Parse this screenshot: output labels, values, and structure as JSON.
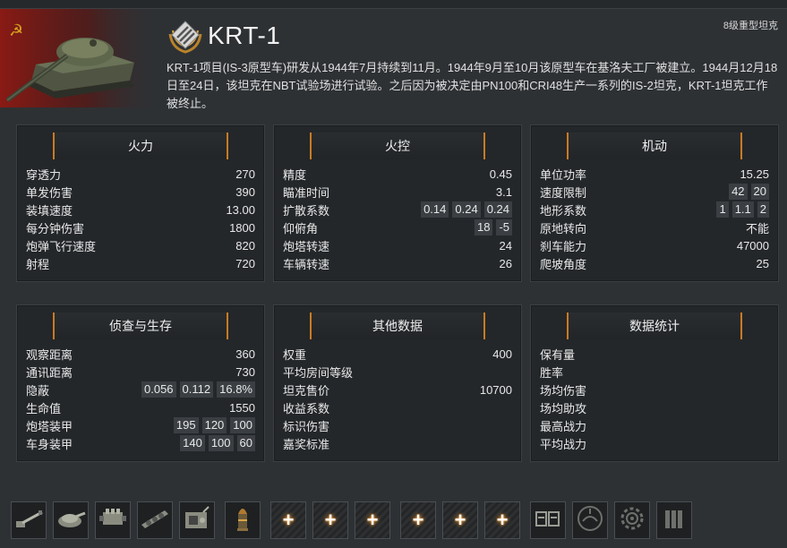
{
  "vehicle": {
    "name": "KRT-1",
    "class_label": "8级重型坦克",
    "description": "KRT-1项目(IS-3原型车)研发从1944年7月持续到11月。1944年9月至10月该原型车在基洛夫工厂被建立。1944月12月18日至24日，该坦克在NBT试验场进行试验。之后因为被决定由PN100和CRI48生产一系列的IS-2坦克，KRT-1坦克工作被终止。"
  },
  "panels": {
    "firepower": {
      "title": "火力",
      "rows": [
        {
          "label": "穿透力",
          "values": [
            "270"
          ]
        },
        {
          "label": "单发伤害",
          "values": [
            "390"
          ]
        },
        {
          "label": "装填速度",
          "values": [
            "13.00"
          ]
        },
        {
          "label": "每分钟伤害",
          "values": [
            "1800"
          ]
        },
        {
          "label": "炮弹飞行速度",
          "values": [
            "820"
          ]
        },
        {
          "label": "射程",
          "values": [
            "720"
          ]
        }
      ]
    },
    "fire_control": {
      "title": "火控",
      "rows": [
        {
          "label": "精度",
          "values": [
            "0.45"
          ]
        },
        {
          "label": "瞄准时间",
          "values": [
            "3.1"
          ]
        },
        {
          "label": "扩散系数",
          "values": [
            "0.14",
            "0.24",
            "0.24"
          ]
        },
        {
          "label": "仰俯角",
          "values": [
            "18",
            "-5"
          ]
        },
        {
          "label": "炮塔转速",
          "values": [
            "24"
          ]
        },
        {
          "label": "车辆转速",
          "values": [
            "26"
          ]
        }
      ]
    },
    "mobility": {
      "title": "机动",
      "rows": [
        {
          "label": "单位功率",
          "values": [
            "15.25"
          ]
        },
        {
          "label": "速度限制",
          "values": [
            "42",
            "20"
          ]
        },
        {
          "label": "地形系数",
          "values": [
            "1",
            "1.1",
            "2"
          ]
        },
        {
          "label": "原地转向",
          "values": [
            "不能"
          ]
        },
        {
          "label": "刹车能力",
          "values": [
            "47000"
          ]
        },
        {
          "label": "爬坡角度",
          "values": [
            "25"
          ]
        }
      ]
    },
    "recon": {
      "title": "侦查与生存",
      "rows": [
        {
          "label": "观察距离",
          "values": [
            "360"
          ]
        },
        {
          "label": "通讯距离",
          "values": [
            "730"
          ]
        },
        {
          "label": "隐蔽",
          "values": [
            "0.056",
            "0.112",
            "16.8%"
          ]
        },
        {
          "label": "生命值",
          "values": [
            "1550"
          ]
        },
        {
          "label": "炮塔装甲",
          "values": [
            "195",
            "120",
            "100"
          ]
        },
        {
          "label": "车身装甲",
          "values": [
            "140",
            "100",
            "60"
          ]
        }
      ]
    },
    "other": {
      "title": "其他数据",
      "rows": [
        {
          "label": "权重",
          "values": [
            "400"
          ]
        },
        {
          "label": "平均房间等级",
          "values": []
        },
        {
          "label": "坦克售价",
          "values": [
            "10700"
          ]
        },
        {
          "label": "收益系数",
          "values": []
        },
        {
          "label": "标识伤害",
          "values": []
        },
        {
          "label": "嘉奖标准",
          "values": []
        }
      ]
    },
    "stats": {
      "title": "数据统计",
      "rows": [
        {
          "label": "保有量",
          "values": []
        },
        {
          "label": "胜率",
          "values": []
        },
        {
          "label": "场均伤害",
          "values": []
        },
        {
          "label": "场均助攻",
          "values": []
        },
        {
          "label": "最高战力",
          "values": []
        },
        {
          "label": "平均战力",
          "values": []
        }
      ]
    }
  },
  "slots": [
    {
      "name": "gun-module-slot",
      "icon": "gun-icon",
      "empty": false
    },
    {
      "name": "turret-module-slot",
      "icon": "turret-icon",
      "empty": false
    },
    {
      "name": "engine-module-slot",
      "icon": "engine-icon",
      "empty": false
    },
    {
      "name": "suspension-module-slot",
      "icon": "suspension-icon",
      "empty": false
    },
    {
      "name": "radio-module-slot",
      "icon": "radio-icon",
      "empty": false
    },
    {
      "name": "ammo-slot",
      "icon": "shell-icon",
      "empty": false,
      "group_gap": true
    },
    {
      "name": "consumable-slot-1",
      "icon": "plus-icon",
      "empty": true,
      "group_gap": true
    },
    {
      "name": "consumable-slot-2",
      "icon": "plus-icon",
      "empty": true
    },
    {
      "name": "consumable-slot-3",
      "icon": "plus-icon",
      "empty": true
    },
    {
      "name": "equipment-slot-1",
      "icon": "plus-icon",
      "empty": true,
      "group_gap": true
    },
    {
      "name": "equipment-slot-2",
      "icon": "plus-icon",
      "empty": true
    },
    {
      "name": "equipment-slot-3",
      "icon": "plus-icon",
      "empty": true
    },
    {
      "name": "crew-skill-slot-1",
      "icon": "crew-icon",
      "empty": false,
      "group_gap": true
    },
    {
      "name": "crew-skill-slot-2",
      "icon": "camo-icon",
      "empty": false
    },
    {
      "name": "crew-skill-slot-3",
      "icon": "gear-icon",
      "empty": false
    },
    {
      "name": "crew-skill-slot-4",
      "icon": "ammo-rack-icon",
      "empty": false
    }
  ],
  "colors": {
    "accent": "#c97b22",
    "background": "#2e3134",
    "panel": "#24272a"
  }
}
